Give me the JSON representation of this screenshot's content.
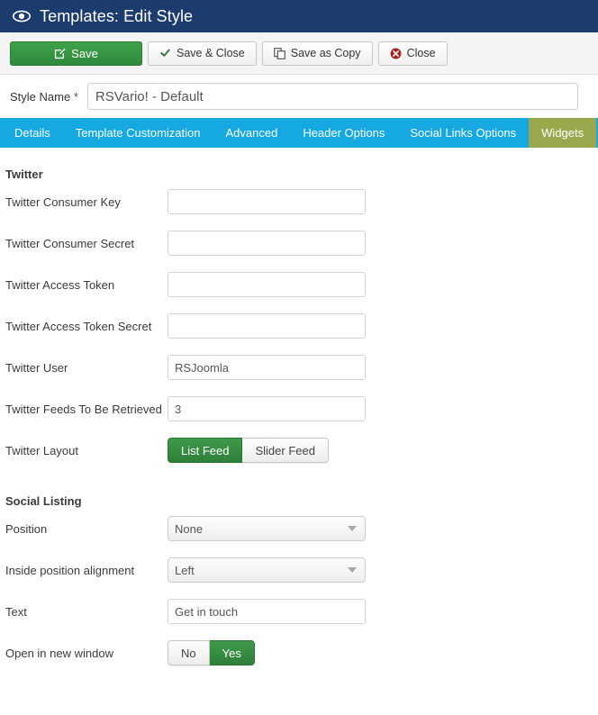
{
  "header": {
    "icon": "eye-icon",
    "title": "Templates: Edit Style",
    "background": "#1d3c6e"
  },
  "toolbar": {
    "buttons": [
      {
        "label": "Save",
        "icon": "pencil-square-icon",
        "style": "primary-green"
      },
      {
        "label": "Save & Close",
        "icon": "check-icon",
        "style": "default"
      },
      {
        "label": "Save as Copy",
        "icon": "copy-icon",
        "style": "default"
      },
      {
        "label": "Close",
        "icon": "cancel-circle-icon",
        "style": "default"
      }
    ]
  },
  "style_name": {
    "label": "Style Name",
    "required_marker": "*",
    "value": "RSVario! - Default",
    "placeholder": ""
  },
  "tabs": {
    "active_color": "#9aa84d",
    "bar_color": "#16a8e0",
    "items": [
      {
        "label": "Details",
        "active": false
      },
      {
        "label": "Template Customization",
        "active": false
      },
      {
        "label": "Advanced",
        "active": false
      },
      {
        "label": "Header Options",
        "active": false
      },
      {
        "label": "Social Links Options",
        "active": false
      },
      {
        "label": "Widgets",
        "active": true
      }
    ]
  },
  "sections": {
    "twitter": {
      "heading": "Twitter",
      "fields": {
        "consumer_key": {
          "label": "Twitter Consumer Key",
          "value": "",
          "placeholder": ""
        },
        "consumer_secret": {
          "label": "Twitter Consumer Secret",
          "value": "",
          "placeholder": ""
        },
        "access_token": {
          "label": "Twitter Access Token",
          "value": "",
          "placeholder": ""
        },
        "access_token_secret": {
          "label": "Twitter Access Token Secret",
          "value": "",
          "placeholder": ""
        },
        "user": {
          "label": "Twitter User",
          "value": "RSJoomla",
          "placeholder": ""
        },
        "feeds": {
          "label": "Twitter Feeds To Be Retrieved",
          "value": "3",
          "placeholder": ""
        },
        "layout": {
          "label": "Twitter Layout",
          "options": [
            "List Feed",
            "Slider Feed"
          ],
          "selected": "List Feed"
        }
      }
    },
    "social_listing": {
      "heading": "Social Listing",
      "fields": {
        "position": {
          "label": "Position",
          "value": "None"
        },
        "alignment": {
          "label": "Inside position alignment",
          "value": "Left"
        },
        "text": {
          "label": "Text",
          "value": "Get in touch",
          "placeholder": ""
        },
        "new_window": {
          "label": "Open in new window",
          "options": [
            "No",
            "Yes"
          ],
          "selected": "Yes"
        }
      }
    }
  }
}
